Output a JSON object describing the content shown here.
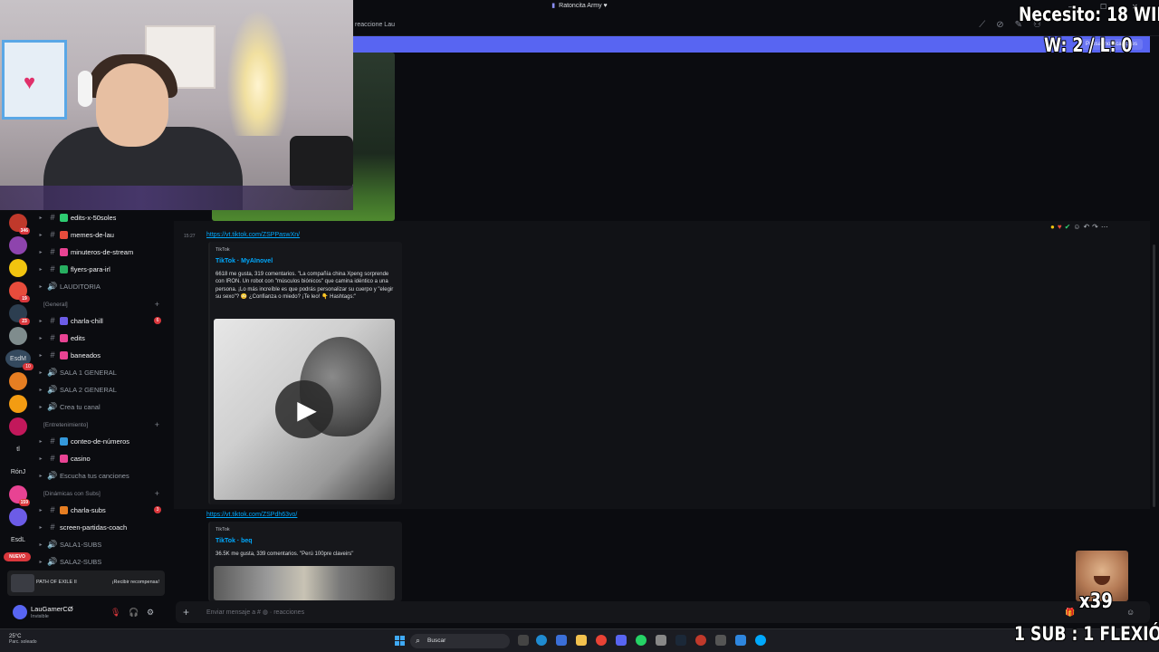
{
  "window": {
    "title": "Ratoncita Army"
  },
  "header": {
    "channel_name": "reaccione Lau"
  },
  "banner": {
    "button_label": "Pausar notificaciones"
  },
  "rail": {
    "servers": [
      {
        "badge": "346",
        "color": "#c0392b"
      },
      {
        "badge": "",
        "color": "#8e44ad"
      },
      {
        "badge": "",
        "color": "#f1c40f"
      },
      {
        "badge": "19",
        "color": "#e74c3c"
      },
      {
        "badge": "23",
        "color": "#2c3e50"
      },
      {
        "badge": "",
        "color": "#7f8c8d"
      },
      {
        "badge": "10",
        "color": "#34495e",
        "label": "EsdM"
      },
      {
        "badge": "",
        "color": "#e67e22"
      },
      {
        "badge": "",
        "color": "#f39c12"
      },
      {
        "badge": "",
        "color": "#c2185b"
      },
      {
        "badge": "",
        "color": "",
        "label": "tl"
      },
      {
        "badge": "",
        "color": "",
        "label": "RónJ"
      },
      {
        "badge": "159",
        "color": "#e84393"
      },
      {
        "badge": "",
        "color": "#6c5ce7"
      },
      {
        "badge": "",
        "color": "",
        "label": "EsdL"
      }
    ],
    "nuevo_label": "NUEVO"
  },
  "channels": {
    "items": [
      {
        "type": "text",
        "label": "edits-x-50soles",
        "emoji_color": "#2ecc71"
      },
      {
        "type": "text",
        "label": "memes-de-lau",
        "emoji_color": "#e74c3c"
      },
      {
        "type": "text",
        "label": "minuteros-de-stream",
        "emoji_color": "#e84393"
      },
      {
        "type": "text",
        "label": "flyers-para-irl",
        "emoji_color": "#27ae60"
      },
      {
        "type": "voice",
        "label": "LAUDITORIA"
      },
      {
        "type": "category",
        "label": "[General]"
      },
      {
        "type": "text",
        "label": "charla-chill",
        "emoji_color": "#6c5ce7",
        "unread": "6"
      },
      {
        "type": "text",
        "label": "edits",
        "emoji_color": "#e84393"
      },
      {
        "type": "text",
        "label": "baneados",
        "emoji_color": "#e84393"
      },
      {
        "type": "voice",
        "label": "SALA 1 GENERAL"
      },
      {
        "type": "voice",
        "label": "SALA 2 GENERAL"
      },
      {
        "type": "voice",
        "label": "Crea tu canal"
      },
      {
        "type": "category",
        "label": "[Entretenimiento]"
      },
      {
        "type": "text",
        "label": "conteo-de-números",
        "emoji_color": "#3498db"
      },
      {
        "type": "text",
        "label": "casino",
        "emoji_color": "#e84393"
      },
      {
        "type": "voice",
        "label": "Escucha tus canciones"
      },
      {
        "type": "category",
        "label": "[Dinámicas con Subs]"
      },
      {
        "type": "text",
        "label": "charla-subs",
        "emoji_color": "#e67e22",
        "unread": "3"
      },
      {
        "type": "text",
        "label": "screen-partidas-coach",
        "emoji_color": ""
      },
      {
        "type": "voice",
        "label": "SALA1-SUBS"
      },
      {
        "type": "voice",
        "label": "SALA2-SUBS"
      }
    ]
  },
  "promo": {
    "title": "PATH OF EXILE II",
    "button": "¡Recibir recompensa!"
  },
  "user": {
    "name": "LauGamerCØ",
    "status": "Invisible"
  },
  "messages": {
    "timestamp": "15:27",
    "msg1": {
      "link": "https://vt.tiktok.com/ZSPPaswXn/",
      "provider": "TikTok",
      "title": "TikTok · MyAInovel",
      "description": "6618 me gusta, 319 comentarios. \"La compañía china Xpeng sorprende con IRON. Un robot con \"músculos biónicos\" que camina idéntico a una persona. ¡Lo más increíble es que podrás personalizar su cuerpo y \"elegir su sexo\"? 😳 ¿Confianza o miedo? ¡Te leo! 👇 Hashtags:\""
    },
    "msg2": {
      "link": "https://vt.tiktok.com/ZSPdh63vo/",
      "provider": "TikTok",
      "title": "TikTok · beq",
      "description": "36.5K me gusta, 339 comentarios. \"Perú 100pre claveirs\""
    }
  },
  "composer": {
    "placeholder": "Enviar mensaje a #",
    "placeholder_suffix": "reacciones"
  },
  "taskbar": {
    "weather_temp": "25°C",
    "weather_desc": "Parc. soleado",
    "search_label": "Buscar"
  },
  "overlay": {
    "wins_needed": "Necesito: 18 WINS",
    "score": "W: 2 / L: 0",
    "multiplier": "x39",
    "rule": "1 SUB : 1 FLEXIÓN"
  },
  "colors": {
    "accent": "#5865f2",
    "link": "#00a8fc",
    "danger": "#da373c",
    "background": "#0b0c10"
  }
}
